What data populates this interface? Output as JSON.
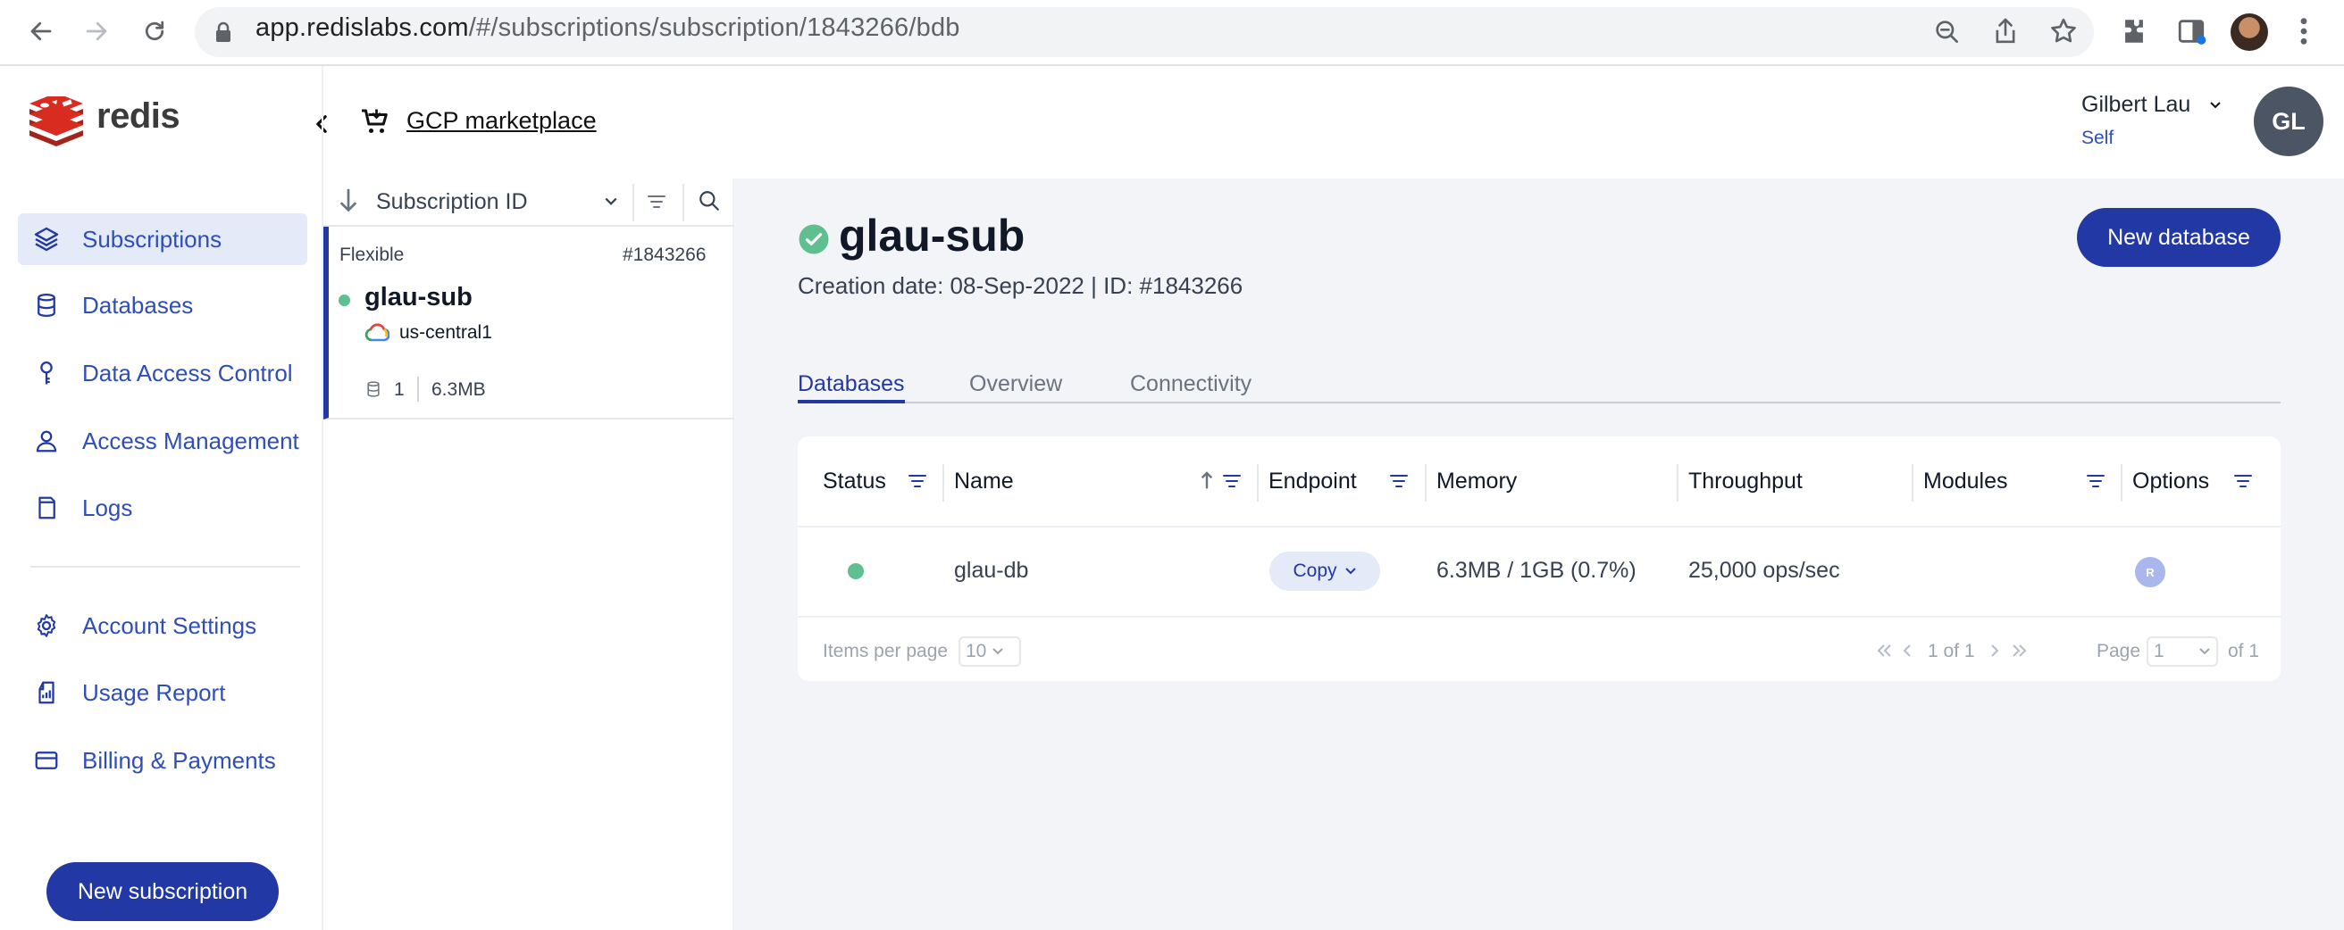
{
  "browser": {
    "url_host": "app.redislabs.com",
    "url_path": "/#/subscriptions/subscription/1843266/bdb"
  },
  "app": {
    "logo_text": "redis",
    "marketplace_label": "GCP marketplace",
    "user": {
      "name": "Gilbert Lau",
      "role": "Self",
      "initials": "GL"
    }
  },
  "sidebar": {
    "items": [
      {
        "label": "Subscriptions",
        "icon": "layers-icon",
        "active": true
      },
      {
        "label": "Databases",
        "icon": "database-icon"
      },
      {
        "label": "Data Access Control",
        "icon": "key-icon"
      },
      {
        "label": "Access Management",
        "icon": "user-icon"
      },
      {
        "label": "Logs",
        "icon": "log-icon"
      },
      {
        "label": "Account Settings",
        "icon": "gear-icon"
      },
      {
        "label": "Usage Report",
        "icon": "report-icon"
      },
      {
        "label": "Billing & Payments",
        "icon": "card-icon"
      }
    ],
    "new_subscription_label": "New subscription"
  },
  "subscription_list": {
    "sort_label": "Subscription ID",
    "card": {
      "plan": "Flexible",
      "id": "#1843266",
      "name": "glau-sub",
      "region": "us-central1",
      "db_count": "1",
      "size": "6.3MB"
    }
  },
  "main": {
    "title": "glau-sub",
    "meta": "Creation date: 08-Sep-2022 | ID: #1843266",
    "new_database_label": "New database",
    "tabs": [
      "Databases",
      "Overview",
      "Connectivity"
    ],
    "table": {
      "headers": [
        "Status",
        "Name",
        "Endpoint",
        "Memory",
        "Throughput",
        "Modules",
        "Options"
      ],
      "rows": [
        {
          "name": "glau-db",
          "endpoint": "Copy",
          "memory": "6.3MB / 1GB (0.7%)",
          "throughput": "25,000 ops/sec",
          "module": "R"
        }
      ]
    },
    "pagination": {
      "items_per_page_label": "Items per page",
      "items_per_page": "10",
      "range": "1 of 1",
      "page_label": "Page",
      "page": "1",
      "of_pages": "of 1"
    }
  },
  "colors": {
    "brand": "#2238a5",
    "status_ok": "#5fbf8f",
    "redis_red": "#d82c20"
  }
}
